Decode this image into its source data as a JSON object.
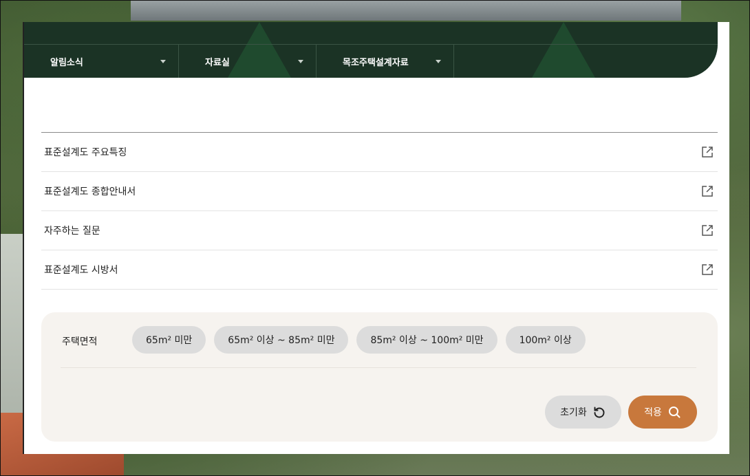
{
  "nav": {
    "items": [
      {
        "label": "알림소식"
      },
      {
        "label": "자료실"
      },
      {
        "label": "목조주택설계자료"
      }
    ]
  },
  "links": [
    {
      "label": "표준설계도 주요특징"
    },
    {
      "label": "표준설계도 종합안내서"
    },
    {
      "label": "자주하는 질문"
    },
    {
      "label": "표준설계도 시방서"
    }
  ],
  "filter": {
    "label": "주택면적",
    "options": [
      {
        "label": "65m² 미만"
      },
      {
        "label": "65m² 이상 ~ 85m² 미만"
      },
      {
        "label": "85m² 이상 ~ 100m² 미만"
      },
      {
        "label": "100m² 이상"
      }
    ],
    "reset_label": "초기화",
    "apply_label": "적용"
  },
  "colors": {
    "nav_bg": "#1b3325",
    "apply_bg": "#c8783c",
    "chip_bg": "#dcdcdc",
    "filter_bg": "#f6f3ef"
  },
  "icons": {
    "nav_caret": "chevron-down-icon",
    "link": "external-link-icon",
    "reset": "refresh-icon",
    "apply": "search-icon"
  }
}
